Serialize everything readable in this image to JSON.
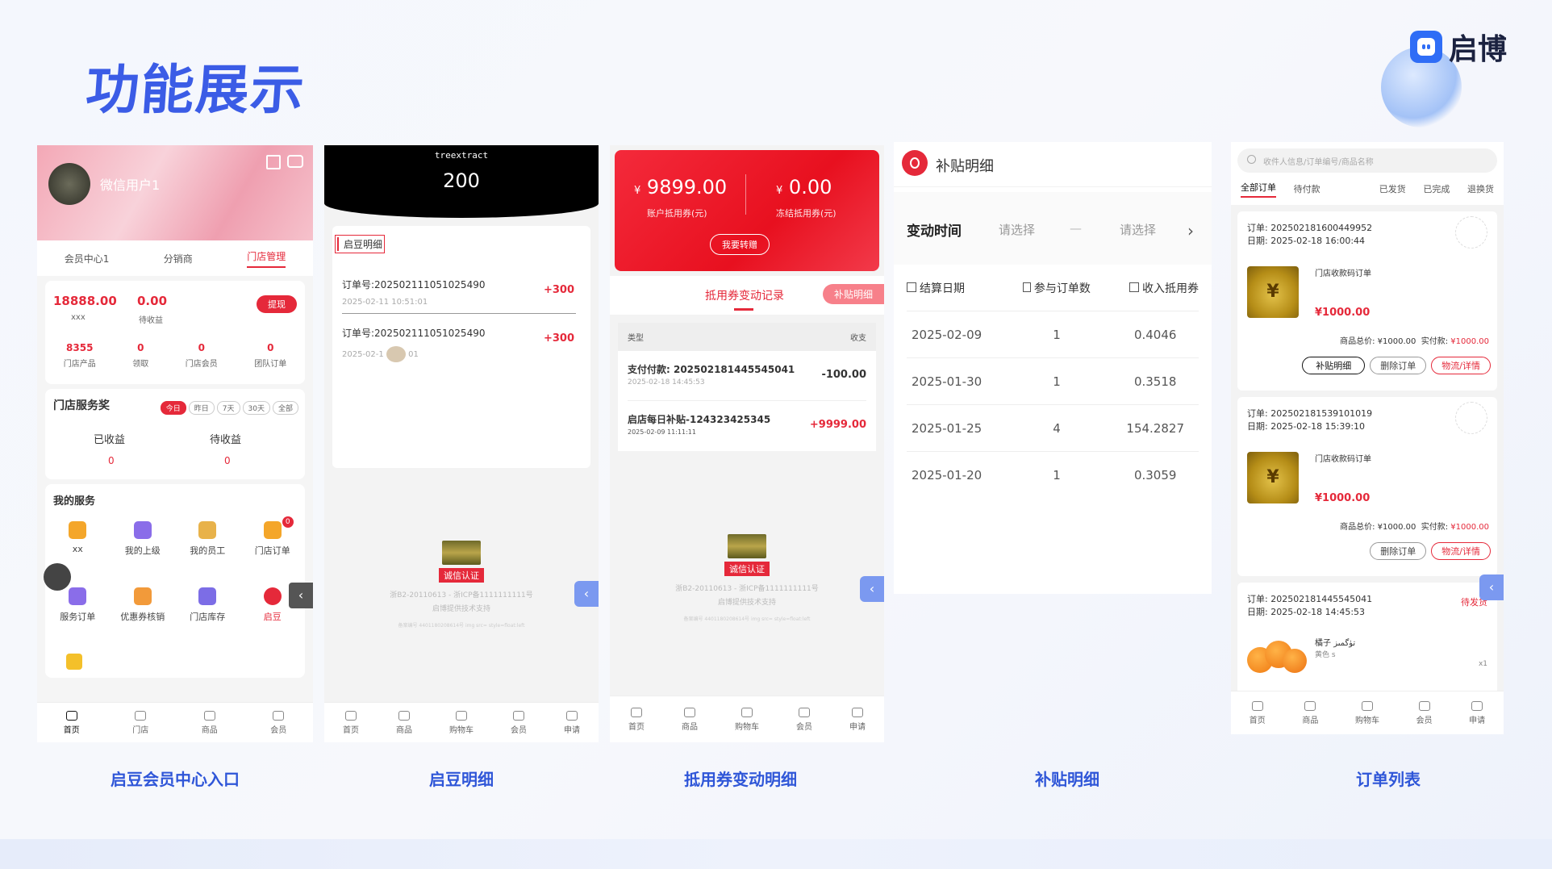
{
  "header": {
    "title": "功能展示",
    "logo_text": "启博"
  },
  "captions": [
    "启豆会员中心入口",
    "启豆明细",
    "抵用券变动明细",
    "补贴明细",
    "订单列表"
  ],
  "nav_bar_a": [
    "首页",
    "门店",
    "商品",
    "会员"
  ],
  "nav_bar_b": [
    "首页",
    "商品",
    "购物车",
    "会员",
    "申请"
  ],
  "screen1": {
    "user_name": "微信用户1",
    "tabs": [
      "会员中心1",
      "分销商",
      "门店管理"
    ],
    "balance": "18888.00",
    "balance_label": "xxx",
    "pending": "0.00",
    "pending_label": "待收益",
    "withdraw": "提现",
    "stats": [
      {
        "value": "8355",
        "label": "门店产品"
      },
      {
        "value": "0",
        "label": "领取"
      },
      {
        "value": "0",
        "label": "门店会员"
      },
      {
        "value": "0",
        "label": "团队订单"
      }
    ],
    "reward_title": "门店服务奖",
    "reward_filters": [
      "今日",
      "昨日",
      "7天",
      "30天",
      "全部"
    ],
    "earned_label": "已收益",
    "earned_value": "0",
    "waiting_label": "待收益",
    "waiting_value": "0",
    "services_title": "我的服务",
    "services": [
      "xx",
      "我的上级",
      "我的员工",
      "门店订单",
      "服务订单",
      "优惠券核销",
      "门店库存",
      "启豆"
    ],
    "order_badge": "0"
  },
  "screen2": {
    "brand": "treextract",
    "total": "200",
    "section_title": "启豆明细",
    "records": [
      {
        "order": "订单号:202502111051025490",
        "time": "2025-02-11 10:51:01",
        "amount": "+300"
      },
      {
        "order": "订单号:202502111051025490",
        "time": "2025-02-1",
        "time_tail": "01",
        "amount": "+300"
      }
    ],
    "cert": "诚信认证",
    "icp": "浙B2-20110613 - 浙ICP备1111111111号",
    "powered": "启博提供技术支持",
    "tiny": "备案编号 4401180208614号 img src= style=float:left"
  },
  "screen3": {
    "account_amount": "9899.00",
    "account_label": "账户抵用券(元)",
    "frozen_amount": "0.00",
    "frozen_label": "冻结抵用券(元)",
    "currency": "¥",
    "transfer_btn": "我要转赠",
    "tab_records": "抵用券变动记录",
    "tab_subsidy": "补贴明细",
    "col_type": "类型",
    "col_amount": "收支",
    "rows": [
      {
        "title": "支付付款: 202502181445545041",
        "time": "2025-02-18 14:45:53",
        "amount": "-100.00"
      },
      {
        "title": "启店每日补贴-124323425345",
        "time": "2025-02-09 11:11:11",
        "amount": "+9999.00"
      }
    ],
    "cert": "诚信认证",
    "icp": "浙B2-20110613 - 浙ICP备1111111111号",
    "powered": "启博提供技术支持",
    "tiny": "备案编号 4401180208614号 img src= style=float:left"
  },
  "screen4": {
    "title": "补贴明细",
    "filter_label": "变动时间",
    "select_a": "请选择",
    "dash": "—",
    "select_b": "请选择",
    "columns": [
      "结算日期",
      "参与订单数",
      "收入抵用券"
    ],
    "rows": [
      [
        "2025-02-09",
        "1",
        "0.4046"
      ],
      [
        "2025-01-30",
        "1",
        "0.3518"
      ],
      [
        "2025-01-25",
        "4",
        "154.2827"
      ],
      [
        "2025-01-20",
        "1",
        "0.3059"
      ]
    ]
  },
  "screen5": {
    "search_placeholder": "收件人信息/订单编号/商品名称",
    "tabs": [
      "全部订单",
      "待付款",
      "已发货",
      "已完成",
      "退换货"
    ],
    "orders": [
      {
        "no": "订单: 202502181600449952",
        "date": "日期: 2025-02-18 16:00:44",
        "product": "门店收款码订单",
        "price": "¥1000.00",
        "total_label": "商品总价:",
        "total": "¥1000.00",
        "paid_label": "实付款:",
        "paid": "¥1000.00",
        "buttons": [
          "补贴明细",
          "删除订单",
          "物流/详情"
        ]
      },
      {
        "no": "订单: 202502181539101019",
        "date": "日期: 2025-02-18 15:39:10",
        "product": "门店收款码订单",
        "price": "¥1000.00",
        "total_label": "商品总价:",
        "total": "¥1000.00",
        "paid_label": "实付款:",
        "paid": "¥1000.00",
        "buttons": [
          "删除订单",
          "物流/详情"
        ]
      },
      {
        "no": "订单: 202502181445545041",
        "date": "日期: 2025-02-18 14:45:53",
        "status": "待发货",
        "product": "橘子 تۈگمىز",
        "spec": "黄色 s",
        "qty": "x1"
      }
    ]
  }
}
